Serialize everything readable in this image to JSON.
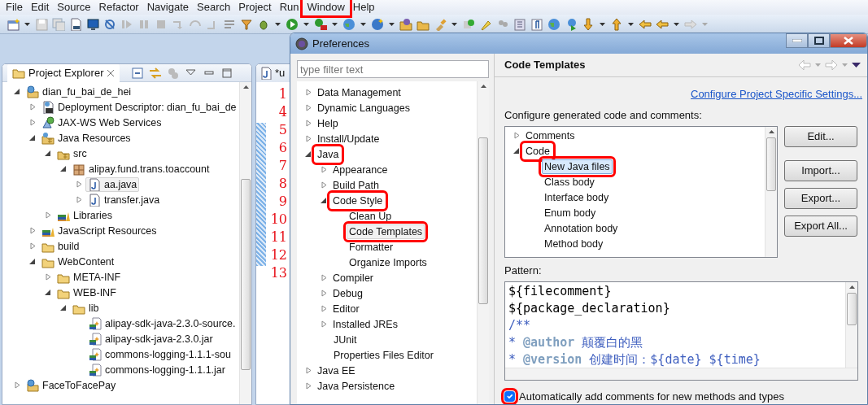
{
  "menu": [
    {
      "label": "File",
      "highlighted": false
    },
    {
      "label": "Edit",
      "highlighted": false
    },
    {
      "label": "Source",
      "highlighted": false
    },
    {
      "label": "Refactor",
      "highlighted": false
    },
    {
      "label": "Navigate",
      "highlighted": false
    },
    {
      "label": "Search",
      "highlighted": false
    },
    {
      "label": "Project",
      "highlighted": false
    },
    {
      "label": "Run",
      "highlighted": false
    },
    {
      "label": "Window",
      "highlighted": true
    },
    {
      "label": "Help",
      "highlighted": false
    }
  ],
  "explorer": {
    "tab": "Project Explorer",
    "tree": [
      {
        "label": "dian_fu_bai_de_hei",
        "kind": "project",
        "expanded": true,
        "selected": false,
        "children": [
          {
            "label": "Deployment Descriptor: dian_fu_bai_de",
            "kind": "descriptor",
            "expanded": false,
            "selected": false
          },
          {
            "label": "JAX-WS Web Services",
            "kind": "webservices",
            "expanded": false,
            "selected": false
          },
          {
            "label": "Java Resources",
            "kind": "resources",
            "expanded": true,
            "selected": false,
            "children": [
              {
                "label": "src",
                "kind": "srcfolder",
                "expanded": true,
                "selected": false,
                "children": [
                  {
                    "label": "alipay.fund.trans.toaccount",
                    "kind": "package",
                    "expanded": true,
                    "selected": false,
                    "children": [
                      {
                        "label": "aa.java",
                        "kind": "java",
                        "expanded": false,
                        "selected": true
                      },
                      {
                        "label": "transfer.java",
                        "kind": "java",
                        "expanded": false,
                        "selected": false
                      }
                    ]
                  }
                ]
              },
              {
                "label": "Libraries",
                "kind": "library",
                "expanded": false,
                "selected": false
              }
            ]
          },
          {
            "label": "JavaScript Resources",
            "kind": "library",
            "expanded": false,
            "selected": false
          },
          {
            "label": "build",
            "kind": "folder",
            "expanded": false,
            "selected": false
          },
          {
            "label": "WebContent",
            "kind": "folder",
            "expanded": true,
            "selected": false,
            "children": [
              {
                "label": "META-INF",
                "kind": "folder",
                "expanded": false,
                "selected": false
              },
              {
                "label": "WEB-INF",
                "kind": "folder",
                "expanded": true,
                "selected": false,
                "children": [
                  {
                    "label": "lib",
                    "kind": "folder",
                    "expanded": true,
                    "selected": false,
                    "children": [
                      {
                        "label": "alipay-sdk-java-2.3.0-source.",
                        "kind": "jar",
                        "selected": false
                      },
                      {
                        "label": "alipay-sdk-java-2.3.0.jar",
                        "kind": "jar",
                        "selected": false
                      },
                      {
                        "label": "commons-logging-1.1.1-sou",
                        "kind": "jar",
                        "selected": false
                      },
                      {
                        "label": "commons-logging-1.1.1.jar",
                        "kind": "jar",
                        "selected": false
                      }
                    ]
                  }
                ]
              }
            ]
          }
        ]
      },
      {
        "label": "FaceToFacePay",
        "kind": "project",
        "expanded": false,
        "selected": false
      }
    ]
  },
  "editor": {
    "tab": "*u",
    "line_numbers": [
      "1",
      "4",
      "5",
      "6",
      "7",
      "8",
      "9",
      "10",
      "11",
      "12",
      "13"
    ]
  },
  "dialog": {
    "title": "Preferences",
    "filter": {
      "placeholder": "type filter text"
    },
    "tree": [
      {
        "label": "Data Management",
        "expanded": false,
        "selected": false,
        "highlighted": false
      },
      {
        "label": "Dynamic Languages",
        "expanded": false,
        "selected": false,
        "highlighted": false
      },
      {
        "label": "Help",
        "expanded": false,
        "selected": false,
        "highlighted": false
      },
      {
        "label": "Install/Update",
        "expanded": false,
        "selected": false,
        "highlighted": false
      },
      {
        "label": "Java",
        "expanded": true,
        "selected": false,
        "highlighted": true,
        "children": [
          {
            "label": "Appearance",
            "expanded": false,
            "selected": false,
            "highlighted": false
          },
          {
            "label": "Build Path",
            "expanded": false,
            "selected": false,
            "highlighted": false
          },
          {
            "label": "Code Style",
            "expanded": true,
            "selected": false,
            "highlighted": true,
            "children": [
              {
                "label": "Clean Up",
                "selected": false,
                "highlighted": false
              },
              {
                "label": "Code Templates",
                "selected": true,
                "highlighted": true
              },
              {
                "label": "Formatter",
                "selected": false,
                "highlighted": false
              },
              {
                "label": "Organize Imports",
                "selected": false,
                "highlighted": false
              }
            ]
          },
          {
            "label": "Compiler",
            "expanded": false,
            "selected": false,
            "highlighted": false
          },
          {
            "label": "Debug",
            "expanded": false,
            "selected": false,
            "highlighted": false
          },
          {
            "label": "Editor",
            "expanded": false,
            "selected": false,
            "highlighted": false
          },
          {
            "label": "Installed JREs",
            "expanded": false,
            "selected": false,
            "highlighted": false
          },
          {
            "label": "JUnit",
            "selected": false,
            "highlighted": false
          },
          {
            "label": "Properties Files Editor",
            "selected": false,
            "highlighted": false
          }
        ]
      },
      {
        "label": "Java EE",
        "expanded": false,
        "selected": false,
        "highlighted": false
      },
      {
        "label": "Java Persistence",
        "expanded": false,
        "selected": false,
        "highlighted": false
      }
    ],
    "page": {
      "title": "Code Templates",
      "link": "Configure Project Specific Settings...",
      "label": "Configure generated code and comments:",
      "templates": [
        {
          "label": "Comments",
          "expanded": false,
          "selected": false,
          "highlighted": false
        },
        {
          "label": "Code",
          "expanded": true,
          "selected": false,
          "highlighted": true,
          "children": [
            {
              "label": "New Java files",
              "selected": true,
              "highlighted": true
            },
            {
              "label": "Class body",
              "selected": false,
              "highlighted": false
            },
            {
              "label": "Interface body",
              "selected": false,
              "highlighted": false
            },
            {
              "label": "Enum body",
              "selected": false,
              "highlighted": false
            },
            {
              "label": "Annotation body",
              "selected": false,
              "highlighted": false
            },
            {
              "label": "Method body",
              "selected": false,
              "highlighted": false
            }
          ]
        }
      ],
      "buttons": [
        "Edit...",
        "Import...",
        "Export...",
        "Export All..."
      ],
      "pattern_label": "Pattern:",
      "pattern": [
        [
          {
            "text": "${filecomment}",
            "kind": "code"
          }
        ],
        [
          {
            "text": "${package_declaration}",
            "kind": "code"
          }
        ],
        [
          {
            "text": "/**",
            "kind": "comment"
          }
        ],
        [
          {
            "text": "* ",
            "kind": "comment"
          },
          {
            "text": "@author",
            "kind": "tag"
          },
          {
            "text": " 颠覆白的黑",
            "kind": "comment"
          }
        ],
        [
          {
            "text": "* ",
            "kind": "comment"
          },
          {
            "text": "@version",
            "kind": "tag"
          },
          {
            "text": " 创建时间：${date} ${time}",
            "kind": "comment"
          }
        ]
      ],
      "auto_comments": {
        "label": "Automatically add comments for new methods and types",
        "checked": true,
        "highlighted": true
      }
    }
  }
}
